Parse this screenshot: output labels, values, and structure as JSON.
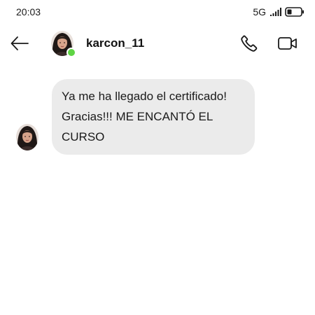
{
  "status_bar": {
    "time": "20:03",
    "network": "5G"
  },
  "header": {
    "username": "karcon_11",
    "online": true,
    "icons": {
      "back": "arrow-left-icon",
      "call": "phone-icon",
      "video": "video-camera-icon"
    }
  },
  "messages": [
    {
      "sender": "karcon_11",
      "direction": "incoming",
      "lines": [
        "Ya me ha llegado el certificado!",
        "Gracias!!! ME ENCANTÓ EL",
        "CURSO"
      ]
    }
  ],
  "colors": {
    "bubble_background": "#ebebeb",
    "online_indicator": "#5fd444",
    "text": "#111111",
    "background": "#ffffff"
  }
}
